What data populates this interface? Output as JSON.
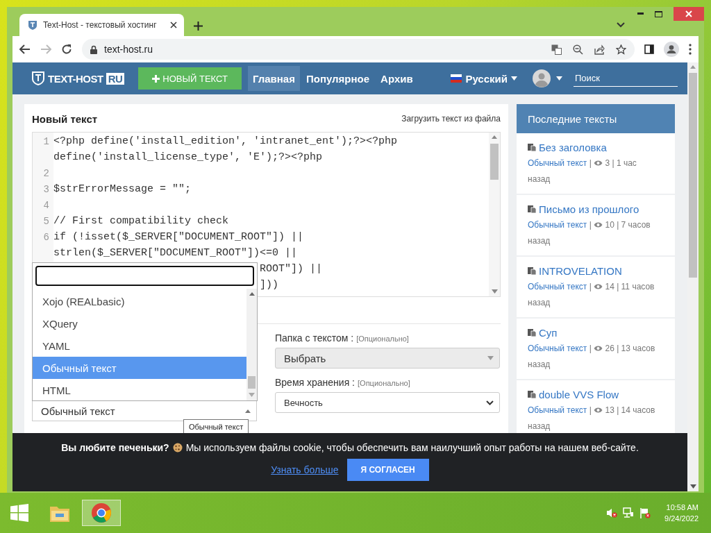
{
  "browser": {
    "tab": {
      "title": "Text-Host - текстовый хостинг"
    },
    "navigation": {
      "back_disabled": false,
      "forward_disabled": true
    },
    "url": "text-host.ru"
  },
  "navbar": {
    "logo": {
      "text": "TEXT-HOST",
      "badge": "RU"
    },
    "new_button": "НОВЫЙ ТЕКСТ",
    "nav_items": [
      {
        "label": "Главная",
        "selected": true
      },
      {
        "label": "Популярное",
        "selected": false
      },
      {
        "label": "Архив",
        "selected": false
      }
    ],
    "language": "Русский",
    "search": {
      "placeholder": "Поиск"
    }
  },
  "editor": {
    "title": "Новый текст",
    "upload_link": "Загрузить текст из файла",
    "lines": [
      {
        "kind": "line",
        "number": "1",
        "text": "<?php define('install_edition', 'intranet_ent');?><?php"
      },
      {
        "kind": "wrap",
        "text": "define('install_license_type', 'E');?><?php"
      },
      {
        "kind": "line",
        "number": "2"
      },
      {
        "kind": "line",
        "number": "3",
        "text": "$strErrorMessage = \"\";"
      },
      {
        "kind": "line",
        "number": "4"
      },
      {
        "kind": "line",
        "number": "5",
        "text": "// First compatibility check"
      },
      {
        "kind": "line",
        "number": "6",
        "text": "if (!isset($_SERVER[\"DOCUMENT_ROOT\"]) ||"
      },
      {
        "kind": "wrap",
        "text": "strlen($_SERVER[\"DOCUMENT_ROOT\"])<=0 ||"
      },
      {
        "kind": "partial",
        "text": "ROOT\"]) ||"
      },
      {
        "kind": "partial",
        "text": "]))"
      }
    ]
  },
  "syntax_dropdown": {
    "options": [
      {
        "label": "Xojo (REALbasic)",
        "selected": false
      },
      {
        "label": "XQuery",
        "selected": false
      },
      {
        "label": "YAML",
        "selected": false
      },
      {
        "label": "Обычный текст",
        "selected": true
      },
      {
        "label": "HTML",
        "selected": false
      }
    ]
  },
  "syntax_select": {
    "value": "Обычный текст"
  },
  "tooltip": "Обычный текст",
  "folder": {
    "label": "Папка с текстом :",
    "hint": "[Опционально]",
    "value": "Выбрать",
    "disabled": true
  },
  "storage": {
    "label": "Время хранения :",
    "hint": "[Опционально]",
    "value": "Вечность",
    "disabled": false
  },
  "sidebar": {
    "title": "Последние тексты",
    "items": [
      {
        "title": "Без заголовка",
        "type": "Обычный текст",
        "sep": "|",
        "stats": "3 | 1 час назад"
      },
      {
        "title": "Письмо из прошлого",
        "type": "Обычный текст",
        "sep": "|",
        "stats": "10 | 7 часов назад"
      },
      {
        "title": "INTROVELATION",
        "type": "Обычный текст",
        "sep": "|",
        "stats": "14 | 11 часов назад"
      },
      {
        "title": "Суп",
        "type": "Обычный текст",
        "sep": "|",
        "stats": "26 | 13 часов назад"
      },
      {
        "title": "double VVS Flow",
        "type": "Обычный текст",
        "sep": "|",
        "stats": "13 | 14 часов назад"
      }
    ]
  },
  "cookie_bar": {
    "lead": "Вы любите печеньки?",
    "text": "Мы используем файлы cookie, чтобы обеспечить вам наилучший опыт работы на нашем веб-сайте.",
    "link": "Узнать больше",
    "button": "Я СОГЛАСЕН"
  },
  "taskbar": {
    "apps": [
      {
        "kind": "explorer",
        "selected": false
      },
      {
        "kind": "chrome",
        "selected": true
      }
    ],
    "clock": {
      "time": "10:58 AM",
      "date": "9/24/2022"
    }
  }
}
